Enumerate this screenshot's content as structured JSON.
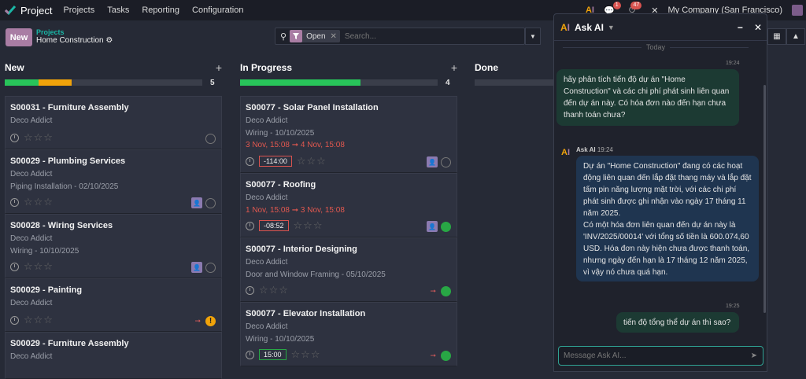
{
  "app": {
    "name": "Project"
  },
  "menu": [
    "Projects",
    "Tasks",
    "Reporting",
    "Configuration"
  ],
  "systray": {
    "chat_count": "1",
    "activity_count": "47",
    "company": "My Company (San Francisco)"
  },
  "control": {
    "new_label": "New",
    "breadcrumb_parent": "Projects",
    "breadcrumb_current": "Home Construction",
    "facet_label": "Open",
    "search_placeholder": "Search..."
  },
  "columns": [
    {
      "title": "New",
      "count": "5",
      "progress": [
        {
          "color": "#28C45A",
          "pct": 17
        },
        {
          "color": "#F0A30A",
          "pct": 17
        }
      ]
    },
    {
      "title": "In Progress",
      "count": "4",
      "progress": [
        {
          "color": "#28C45A",
          "pct": 61
        }
      ]
    },
    {
      "title": "Done"
    }
  ],
  "cards_new": [
    {
      "title": "S00031 - Furniture Assembly",
      "customer": "Deco Addict"
    },
    {
      "title": "S00029 - Plumbing Services",
      "customer": "Deco Addict",
      "sub": "Piping Installation - 02/10/2025"
    },
    {
      "title": "S00028 - Wiring Services",
      "customer": "Deco Addict",
      "sub": "Wiring - 10/10/2025"
    },
    {
      "title": "S00029 - Painting",
      "customer": "Deco Addict"
    },
    {
      "title": "S00029 - Furniture Assembly",
      "customer": "Deco Addict"
    }
  ],
  "cards_progress": [
    {
      "title": "S00077 - Solar Panel Installation",
      "customer": "Deco Addict",
      "sub": "Wiring - 10/10/2025",
      "date_from": "3 Nov, 15:08",
      "date_to": "4 Nov, 15:08",
      "hours": "-114:00"
    },
    {
      "title": "S00077 - Roofing",
      "customer": "Deco Addict",
      "date_from": "1 Nov, 15:08",
      "date_to": "3 Nov, 15:08",
      "hours": "-08:52"
    },
    {
      "title": "S00077 - Interior Designing",
      "customer": "Deco Addict",
      "sub": "Door and Window Framing - 05/10/2025"
    },
    {
      "title": "S00077 - Elevator Installation",
      "customer": "Deco Addict",
      "sub": "Wiring - 10/10/2025",
      "hours": "15:00"
    }
  ],
  "chat": {
    "title": "Ask AI",
    "day": "Today",
    "msg1_time": "19:24",
    "msg1": "hãy phân tích tiến độ dự án \"Home Construction\" và các chi phí phát sinh liên quan đến dự án này. Có hóa đơn nào đến hạn chưa thanh toán chưa?",
    "ai_name": "Ask AI",
    "ai_time": "19:24",
    "ai_p1": "Dự án \"Home Construction\" đang có các hoạt động liên quan đến lắp đặt thang máy và lắp đặt tấm pin năng lượng mặt trời, với các chi phí phát sinh được ghi nhận vào ngày 17 tháng 11 năm 2025.",
    "ai_p2": "Có một hóa đơn liên quan đến dự án này là 'INV/2025/00014' với tổng số tiền là 600.074,60 USD. Hóa đơn này hiện chưa được thanh toán, nhưng ngày đến hạn là 17 tháng 12 năm 2025, vì vậy nó chưa quá hạn.",
    "msg2_time": "19:25",
    "msg2": "tiến độ tổng thể dự án thì sao?",
    "input_placeholder": "Message Ask AI..."
  }
}
